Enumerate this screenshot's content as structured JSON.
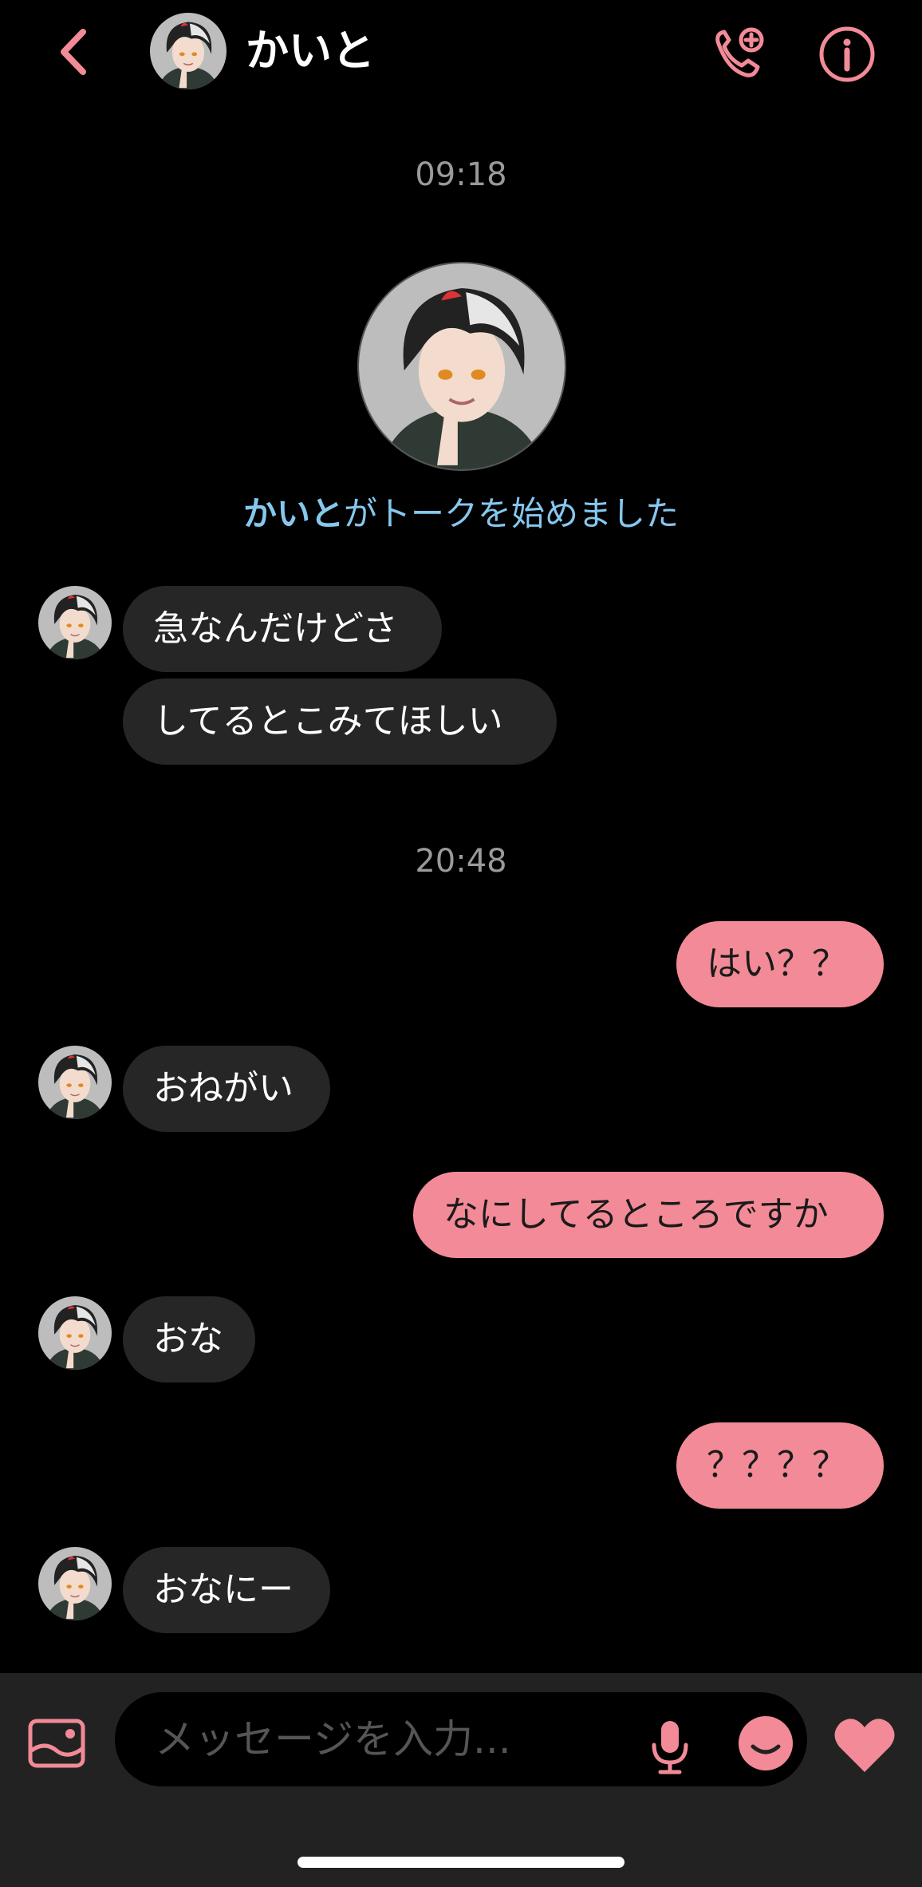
{
  "header": {
    "back_icon": "chevron-left-icon",
    "contact_name": "かいと",
    "call_icon": "phone-add-icon",
    "info_icon": "info-icon"
  },
  "colors": {
    "accent": "#f28b97",
    "incoming_bubble": "#262626",
    "background": "#000000",
    "link_blue": "#86c7ee"
  },
  "chat": {
    "time_1": "09:18",
    "started_name": "かいと",
    "started_text": "がトークを始めました",
    "time_2": "20:48",
    "messages": [
      {
        "side": "in",
        "text": "急なんだけどさ"
      },
      {
        "side": "in",
        "text": "してるとこみてほしい"
      },
      {
        "side": "out",
        "text": "はい？？"
      },
      {
        "side": "in",
        "text": "おねがい"
      },
      {
        "side": "out",
        "text": "なにしてるところですか"
      },
      {
        "side": "in",
        "text": "おな"
      },
      {
        "side": "out",
        "text": "？？？？"
      },
      {
        "side": "in",
        "text": "おなにー"
      }
    ]
  },
  "composer": {
    "gallery_icon": "image-icon",
    "placeholder": "メッセージを入力...",
    "mic_icon": "microphone-icon",
    "emoji_icon": "emoji-icon",
    "like_icon": "heart-icon"
  }
}
